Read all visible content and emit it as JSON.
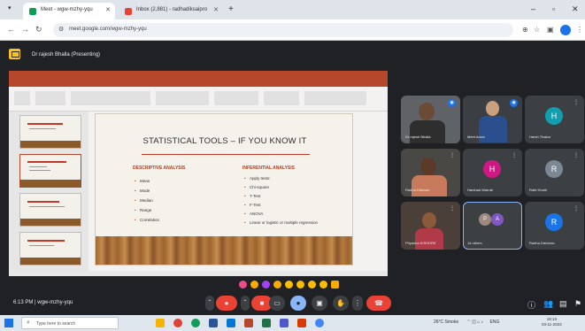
{
  "browser": {
    "tabs": [
      {
        "label": "Meet - wgw-mzhy-yqu",
        "active": true,
        "favicon_color": "#0f9d58"
      },
      {
        "label": "Inbox (2,881) - radhadiksaipro",
        "active": false,
        "favicon_color": "#ea4335"
      }
    ],
    "new_tab_label": "+",
    "url": "meet.google.com/wgw-mzhy-yqu"
  },
  "meet": {
    "presenter_label": "Dr rajesh Bhalla (Presenting)",
    "time": "6:13 PM",
    "meeting_code": "wgw-mzhy-yqu"
  },
  "slide": {
    "title": "STATISTICAL TOOLS – IF YOU KNOW IT",
    "left_heading": "DESCRIPTIVE ANALYSIS",
    "left_items": [
      "Mean",
      "Mode",
      "Median",
      "Range",
      "Correlation"
    ],
    "right_heading": "INFERENTIAL ANALYSIS",
    "right_items": [
      "Apply tests:",
      "Chi-square",
      "T-Test",
      "F-Test",
      "ANOVA",
      "Linear or logistic or multiple regression"
    ]
  },
  "participants": [
    {
      "name": "Dr rajesh Bhalla",
      "type": "video",
      "speaking": true
    },
    {
      "name": "Meet Arora",
      "type": "video",
      "speaking": true
    },
    {
      "name": "Harsh Thakur",
      "type": "avatar",
      "initial": "H",
      "color": "#129eaf"
    },
    {
      "name": "Radha Dikshan",
      "type": "video",
      "speaking": false
    },
    {
      "name": "Harshad Warrde",
      "type": "avatar",
      "initial": "H",
      "color": "#d01884"
    },
    {
      "name": "Rafe Khatri",
      "type": "avatar",
      "initial": "R",
      "color": "#7b8794"
    },
    {
      "name": "Priyanka KISHORE",
      "type": "video",
      "speaking": false
    },
    {
      "name": "14 others",
      "type": "group",
      "initials": [
        "P",
        "A"
      ]
    },
    {
      "name": "Radha Dishman",
      "type": "avatar",
      "initial": "R",
      "color": "#1a73e8"
    }
  ],
  "controls": {
    "mic_icon": "mic-off-icon",
    "camera_icon": "camera-off-icon",
    "captions_icon": "captions-icon",
    "reactions_icon": "emoji-icon",
    "present_icon": "present-icon",
    "raise_hand_icon": "hand-icon",
    "more_icon": "more-vertical-icon",
    "leave_icon": "call-end-icon"
  },
  "taskbar": {
    "search_placeholder": "Type here to search",
    "weather": "26°C Smoke",
    "lang": "ENG",
    "time": "18:13",
    "date": "03-11-2023"
  }
}
